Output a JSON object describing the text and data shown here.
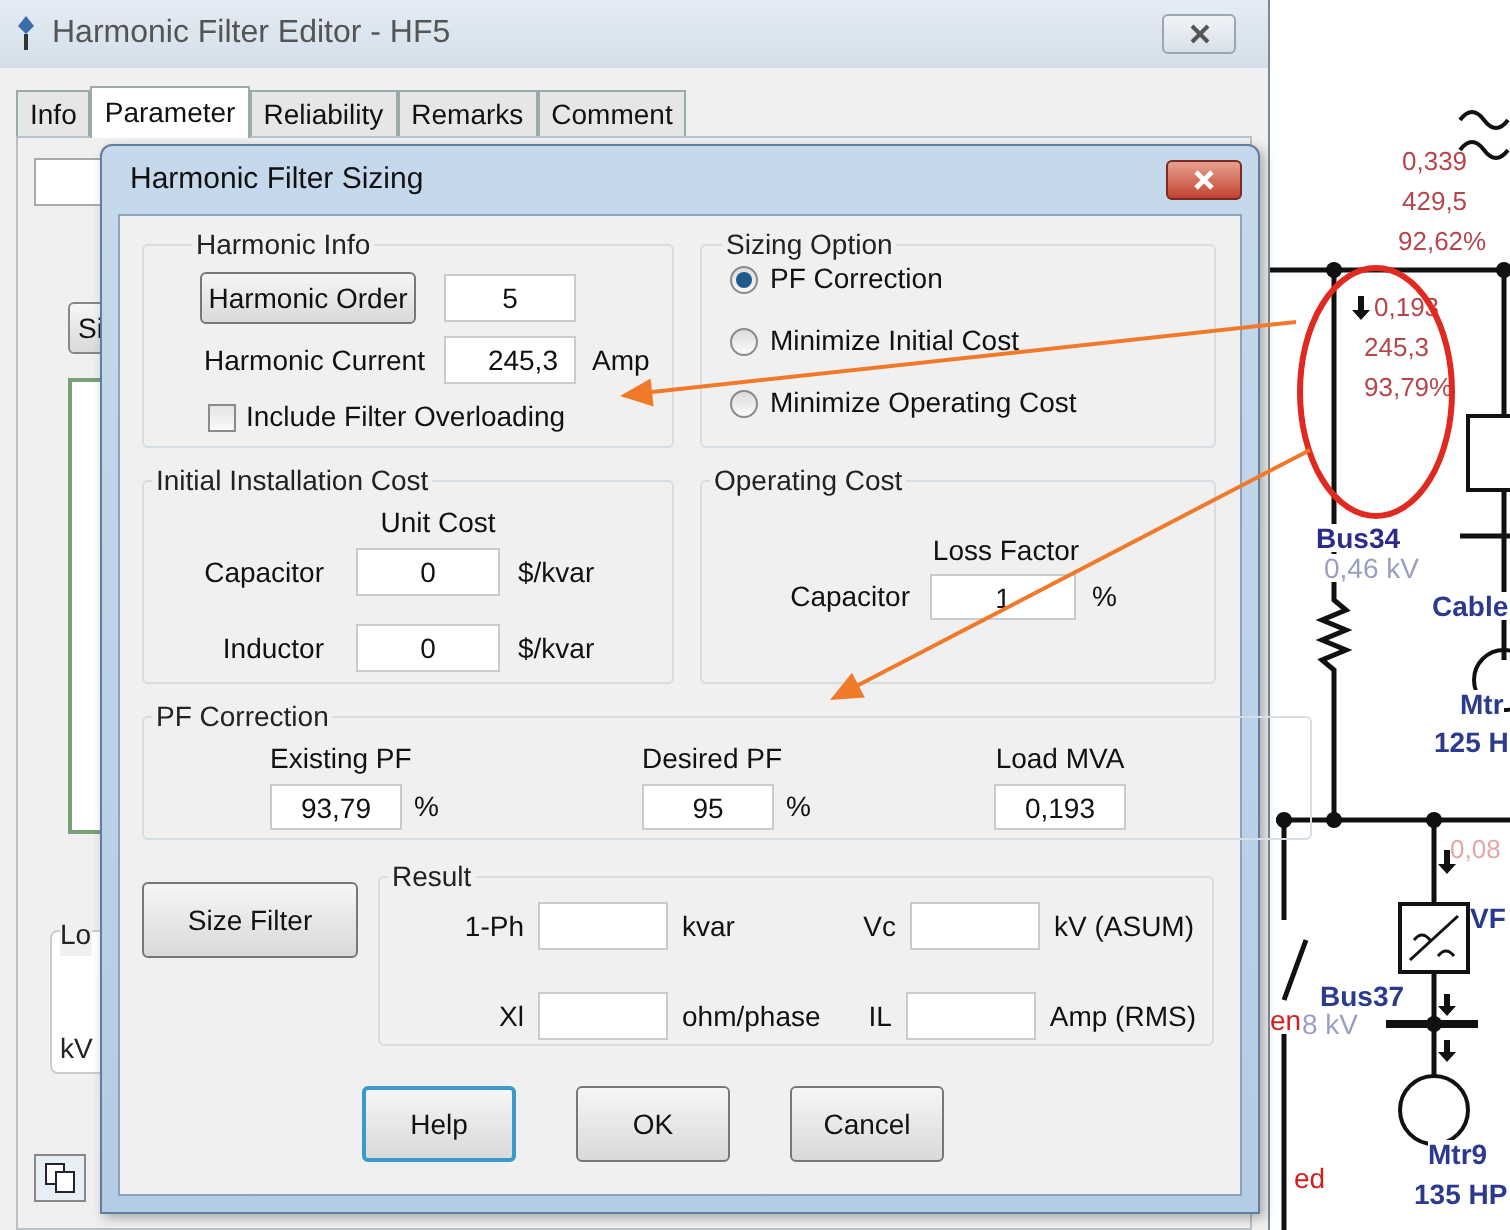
{
  "editor_window": {
    "title": "Harmonic Filter Editor - HF5",
    "tabs": [
      {
        "label": "Info",
        "selected": false
      },
      {
        "label": "Parameter",
        "selected": true
      },
      {
        "label": "Reliability",
        "selected": false
      },
      {
        "label": "Remarks",
        "selected": false
      },
      {
        "label": "Comment",
        "selected": false
      }
    ],
    "button_fragment": "Si",
    "group_fragment": "Lo",
    "label_fragment": "kV"
  },
  "dialog": {
    "title": "Harmonic Filter Sizing",
    "harmonic_info": {
      "title": "Harmonic Info",
      "order_button": "Harmonic Order",
      "order_value": "5",
      "current_label": "Harmonic Current",
      "current_value": "245,3",
      "current_unit": "Amp",
      "overload_checkbox": {
        "label": "Include Filter Overloading",
        "checked": false
      }
    },
    "sizing_option": {
      "title": "Sizing Option",
      "options": [
        {
          "label": "PF Correction",
          "selected": true
        },
        {
          "label": "Minimize Initial Cost",
          "selected": false
        },
        {
          "label": "Minimize Operating Cost",
          "selected": false
        }
      ]
    },
    "initial_cost": {
      "title": "Initial Installation Cost",
      "column_heading": "Unit Cost",
      "rows": [
        {
          "label": "Capacitor",
          "value": "0",
          "unit": "$/kvar"
        },
        {
          "label": "Inductor",
          "value": "0",
          "unit": "$/kvar"
        }
      ]
    },
    "operating_cost": {
      "title": "Operating Cost",
      "column_heading": "Loss Factor",
      "label": "Capacitor",
      "value": "1",
      "unit": "%"
    },
    "pf_correction": {
      "title": "PF Correction",
      "fields": [
        {
          "label": "Existing PF",
          "value": "93,79",
          "unit": "%"
        },
        {
          "label": "Desired PF",
          "value": "95",
          "unit": "%"
        },
        {
          "label": "Load MVA",
          "value": "0,193"
        }
      ]
    },
    "size_button": "Size Filter",
    "result": {
      "title": "Result",
      "fields": [
        {
          "label": "1-Ph",
          "unit": "kvar"
        },
        {
          "label": "Vc",
          "unit": "kV (ASUM)"
        },
        {
          "label": "Xl",
          "unit": "ohm/phase"
        },
        {
          "label": "IL",
          "unit": "Amp (RMS)"
        }
      ]
    },
    "buttons": [
      {
        "label": "Help",
        "focused": true
      },
      {
        "label": "OK",
        "focused": false
      },
      {
        "label": "Cancel",
        "focused": false
      }
    ]
  },
  "diagram": {
    "labels": [
      {
        "text": "0,339",
        "kind": "value"
      },
      {
        "text": "429,5",
        "kind": "value"
      },
      {
        "text": "92,62%",
        "kind": "value"
      },
      {
        "text": "0,193",
        "kind": "value"
      },
      {
        "text": "245,3",
        "kind": "value"
      },
      {
        "text": "93,79%",
        "kind": "value"
      },
      {
        "text": "Bus34",
        "kind": "bus"
      },
      {
        "text": "0,46 kV",
        "kind": "voltage"
      },
      {
        "text": "Cable",
        "kind": "device"
      },
      {
        "text": "Mtr",
        "kind": "device"
      },
      {
        "text": "125 H",
        "kind": "device"
      },
      {
        "text": "0,08",
        "kind": "faint"
      },
      {
        "text": "VF",
        "kind": "device"
      },
      {
        "text": "Bus37",
        "kind": "device"
      },
      {
        "text": "8 kV",
        "kind": "voltage"
      },
      {
        "text": "en",
        "kind": "alert"
      },
      {
        "text": "ed",
        "kind": "alert"
      },
      {
        "text": "Mtr9",
        "kind": "device"
      },
      {
        "text": "135 HP",
        "kind": "device"
      }
    ]
  }
}
